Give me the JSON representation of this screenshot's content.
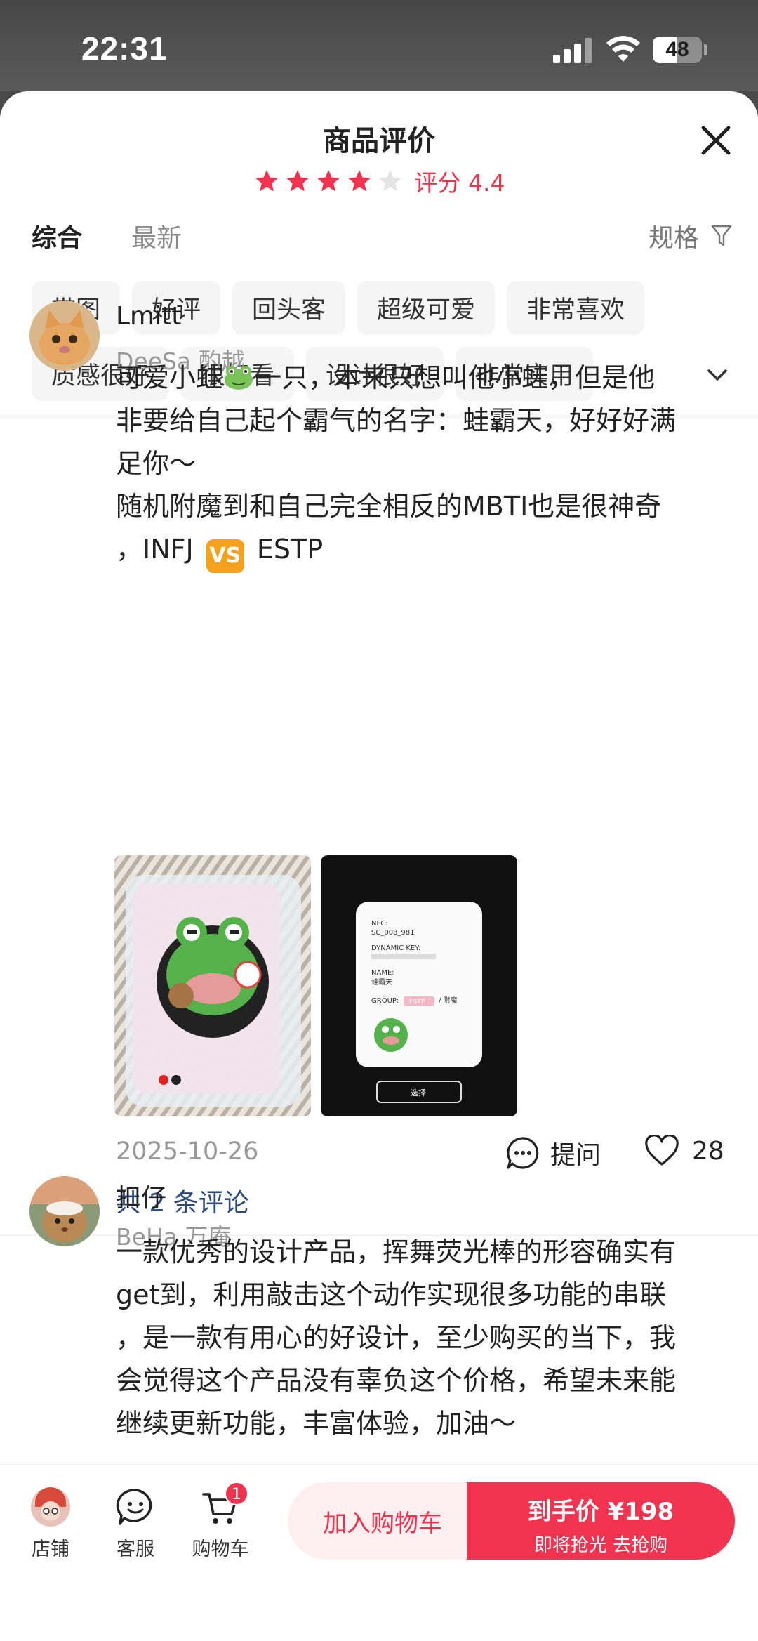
{
  "status": {
    "time": "22:31",
    "battery": "48",
    "battery_level": 0.48
  },
  "sheet": {
    "title": "商品评价",
    "rating_stars": 4,
    "rating_max": 5,
    "rating_text": "评分 4.4"
  },
  "tabs": [
    {
      "label": "综合",
      "active": true
    },
    {
      "label": "最新",
      "active": false
    }
  ],
  "spec_filter": {
    "label": "规格"
  },
  "chips_row1": [
    "带图",
    "好评",
    "回头客",
    "超级可爱",
    "非常喜欢"
  ],
  "chips_row2": [
    "质感很好",
    "很好看",
    "设计很好",
    "非常实用"
  ],
  "reviews": [
    {
      "name": "Lmitt",
      "sub": "DeeSa 酌越",
      "text_line1_a": "可爱小蛙",
      "text_line1_b": "一只，本来只想叫他小蛙，但是他",
      "text_line2": "非要给自己起个霸气的名字：蛙霸天，好好好满",
      "text_line3": "足你～",
      "text_line4": "随机附魔到和自己完全相反的MBTI也是很神奇",
      "text_line5_a": "，INFJ",
      "text_line5_vs": "VS",
      "text_line5_b": "ESTP",
      "date": "2025-10-26",
      "ask_label": "提问",
      "likes": "28",
      "comment_link": "共 2 条评论",
      "photo2": {
        "nfc_label": "NFC:",
        "nfc_value": "SC_008_981",
        "key_label": "DYNAMIC KEY:",
        "name_label": "NAME:",
        "name_value": "蛙霸天",
        "group_label": "GROUP:",
        "group_value": "ESTP",
        "group_suffix": "/ 附魔",
        "select_button": "选择"
      }
    },
    {
      "name": "扣仔",
      "sub": "BeHa 万庵",
      "lines": [
        "一款优秀的设计产品，挥舞荧光棒的形容确实有",
        "get到，利用敲击这个动作实现很多功能的串联",
        "，是一款有用心的好设计，至少购买的当下，我",
        "会觉得这个产品没有辜负这个价格，希望未来能",
        "继续更新功能，丰富体验，加油～"
      ]
    }
  ],
  "bottom": {
    "store": "店铺",
    "service": "客服",
    "cart": "购物车",
    "cart_count": "1",
    "add_to_cart": "加入购物车",
    "buy_main": "到手价 ¥198",
    "buy_sub": "即将抢光  去抢购"
  },
  "colors": {
    "accent": "#f0334e",
    "link": "#2f4b7c",
    "muted": "#999999"
  }
}
